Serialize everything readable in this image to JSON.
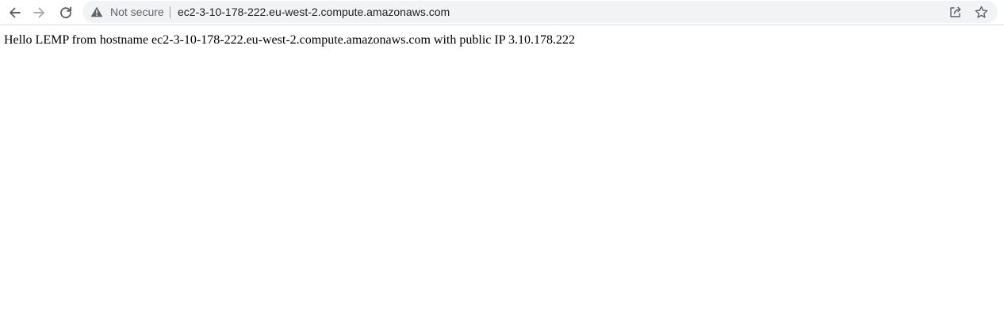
{
  "browser": {
    "security_label": "Not secure",
    "url": "ec2-3-10-178-222.eu-west-2.compute.amazonaws.com",
    "icons": {
      "back": "arrow-left-icon",
      "forward": "arrow-right-icon",
      "reload": "reload-icon",
      "security": "warning-triangle-icon",
      "share": "share-icon",
      "bookmark": "star-icon"
    },
    "colors": {
      "omnibox_bg": "#f1f3f4",
      "icon": "#5f6368",
      "forward_disabled": "#a8abaf"
    }
  },
  "page": {
    "body_text": "Hello LEMP from hostname ec2-3-10-178-222.eu-west-2.compute.amazonaws.com with public IP 3.10.178.222"
  }
}
